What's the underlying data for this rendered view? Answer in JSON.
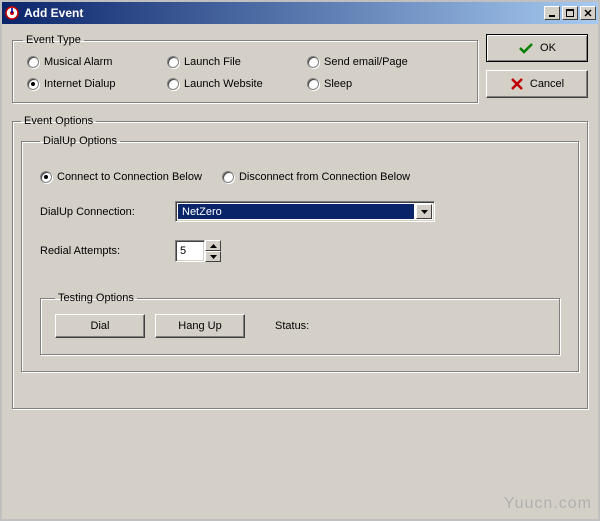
{
  "window": {
    "title": "Add Event"
  },
  "event_type": {
    "legend": "Event Type",
    "options": {
      "musical_alarm": "Musical Alarm",
      "launch_file": "Launch File",
      "send_email": "Send email/Page",
      "internet_dialup": "Internet Dialup",
      "launch_website": "Launch Website",
      "sleep": "Sleep"
    },
    "selected": "internet_dialup"
  },
  "buttons": {
    "ok": "OK",
    "cancel": "Cancel"
  },
  "event_options": {
    "legend": "Event Options"
  },
  "dialup": {
    "legend": "DialUp Options",
    "connect_option": "Connect to Connection Below",
    "disconnect_option": "Disconnect from Connection Below",
    "selected": "connect",
    "connection_label": "DialUp Connection:",
    "connection_value": "NetZero",
    "redial_label": "Redial Attempts:",
    "redial_value": "5"
  },
  "testing": {
    "legend": "Testing Options",
    "dial": "Dial",
    "hangup": "Hang Up",
    "status_label": "Status:"
  },
  "watermark": "Yuucn.com"
}
